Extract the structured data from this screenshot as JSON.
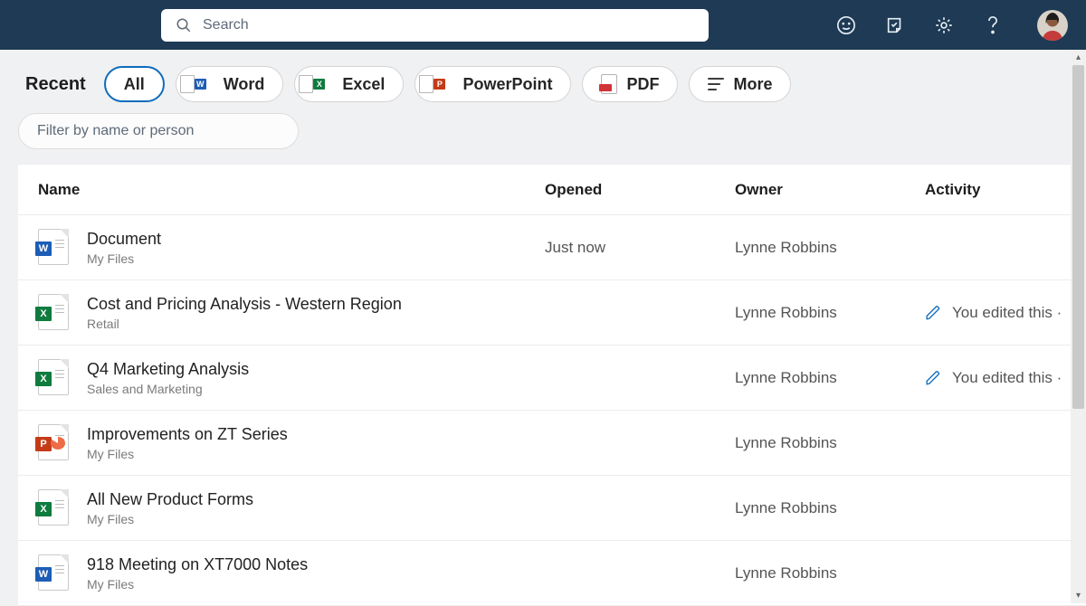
{
  "header": {
    "search_placeholder": "Search"
  },
  "filters": {
    "recent_label": "Recent",
    "all": "All",
    "word": "Word",
    "excel": "Excel",
    "ppt": "PowerPoint",
    "pdf": "PDF",
    "more": "More",
    "filter_placeholder": "Filter by name or person"
  },
  "columns": {
    "name": "Name",
    "opened": "Opened",
    "owner": "Owner",
    "activity": "Activity"
  },
  "files": [
    {
      "name": "Document",
      "location": "My Files",
      "opened": "Just now",
      "owner": "Lynne Robbins",
      "activity": "",
      "type": "word"
    },
    {
      "name": "Cost and Pricing Analysis - Western Region",
      "location": "Retail",
      "opened": "",
      "owner": "Lynne Robbins",
      "activity": "You edited this ·",
      "type": "excel"
    },
    {
      "name": "Q4 Marketing Analysis",
      "location": "Sales and Marketing",
      "opened": "",
      "owner": "Lynne Robbins",
      "activity": "You edited this ·",
      "type": "excel"
    },
    {
      "name": "Improvements on ZT Series",
      "location": "My Files",
      "opened": "",
      "owner": "Lynne Robbins",
      "activity": "",
      "type": "ppt"
    },
    {
      "name": "All New Product Forms",
      "location": "My Files",
      "opened": "",
      "owner": "Lynne Robbins",
      "activity": "",
      "type": "excel"
    },
    {
      "name": "918 Meeting on XT7000 Notes",
      "location": "My Files",
      "opened": "",
      "owner": "Lynne Robbins",
      "activity": "",
      "type": "word"
    }
  ]
}
